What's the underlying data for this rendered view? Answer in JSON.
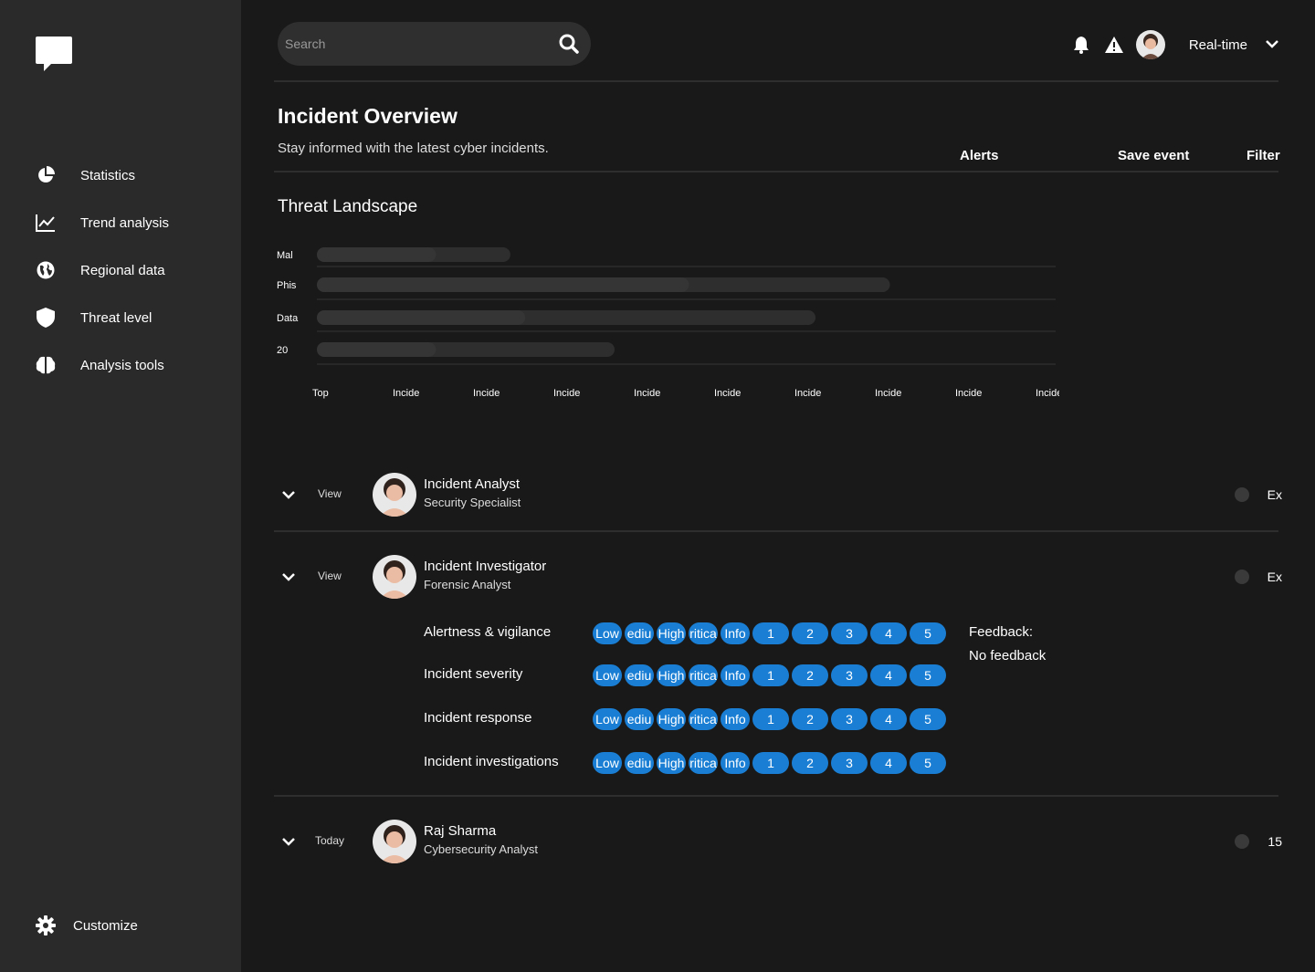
{
  "sidebar": {
    "items": [
      {
        "label": "Statistics",
        "icon": "pie-chart-icon"
      },
      {
        "label": "Trend analysis",
        "icon": "line-chart-icon"
      },
      {
        "label": "Regional data",
        "icon": "globe-icon"
      },
      {
        "label": "Threat level",
        "icon": "shield-icon"
      },
      {
        "label": "Analysis tools",
        "icon": "brain-icon"
      }
    ],
    "customize_label": "Customize"
  },
  "header": {
    "search_placeholder": "Search",
    "mode_label": "Real-time"
  },
  "page": {
    "title": "Incident Overview",
    "subtitle": "Stay informed with the latest cyber incidents.",
    "actions": [
      "Alerts",
      "Save event",
      "Filter"
    ]
  },
  "threat": {
    "title": "Threat Landscape"
  },
  "chart_data": {
    "type": "bar",
    "orientation": "horizontal",
    "categories": [
      "Mal",
      "Phis",
      "Data",
      "20"
    ],
    "series": [
      {
        "values": [
          0.26,
          0.77,
          0.67,
          0.4
        ]
      },
      {
        "values": [
          0.16,
          0.5,
          0.28,
          0.16
        ]
      }
    ],
    "xlim": [
      0,
      1
    ],
    "x_tick_labels": [
      "Top",
      "Incide",
      "Incide",
      "Incide",
      "Incide",
      "Incide",
      "Incide",
      "Incide",
      "Incide",
      "Incide"
    ],
    "grid": true,
    "colors": {
      "track": "#2e2e2e",
      "bar": "#353535"
    }
  },
  "people": [
    {
      "view": "View",
      "name": "Incident Analyst",
      "role": "Security Specialist",
      "tail": "Ex"
    },
    {
      "view": "View",
      "name": "Incident Investigator",
      "role": "Forensic Analyst",
      "tail": "Ex"
    },
    {
      "view": "Today",
      "name": "Raj Sharma",
      "role": "Cybersecurity Analyst",
      "tail": "15"
    }
  ],
  "ratings": {
    "labels": [
      "Alertness & vigilance",
      "Incident severity",
      "Incident response",
      "Incident investigations"
    ],
    "options": [
      "Low",
      "ediu",
      "High",
      "ritica",
      "Info",
      "1",
      "2",
      "3",
      "4",
      "5"
    ],
    "feedback_label": "Feedback:",
    "feedback_value": "No feedback"
  },
  "colors": {
    "accent": "#1a7fd4",
    "sidebar": "#2a2a2a",
    "background": "#191919"
  }
}
